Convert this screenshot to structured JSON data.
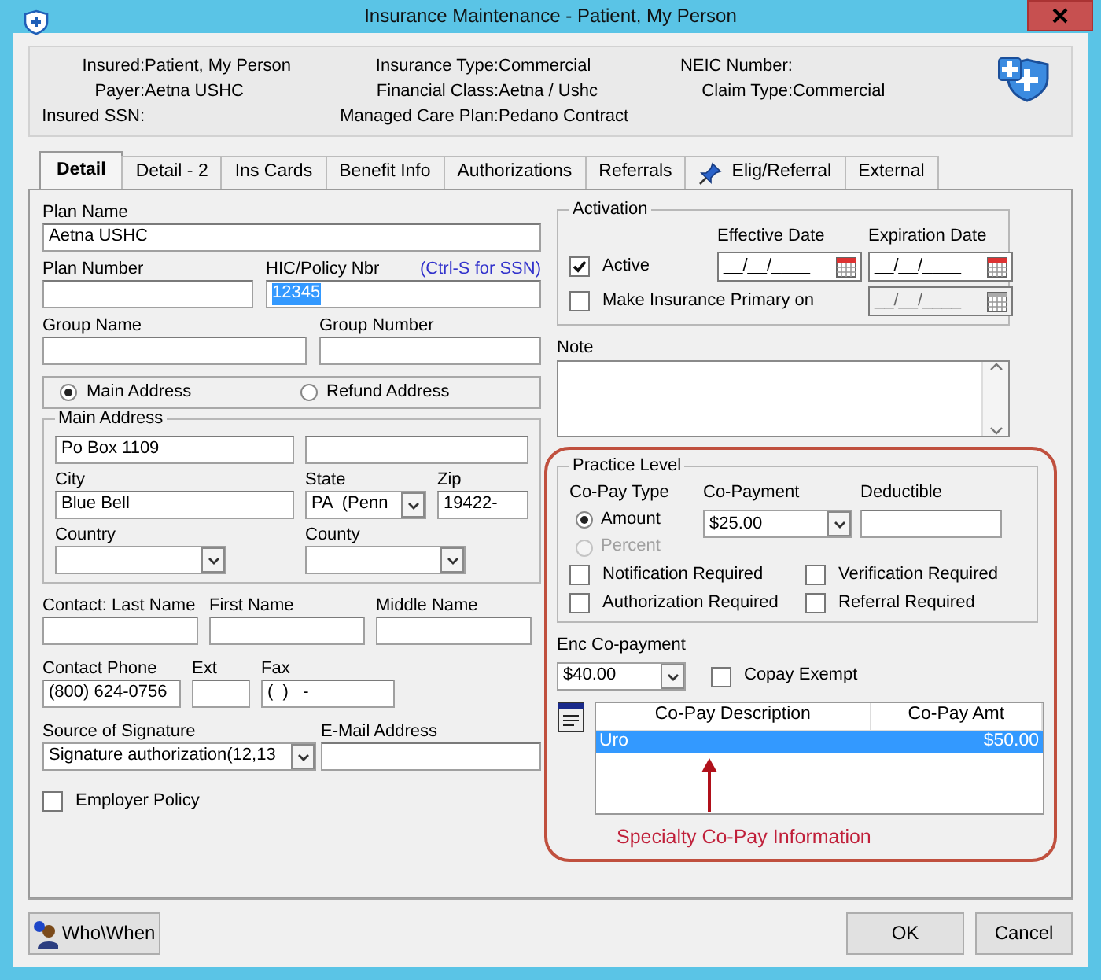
{
  "window": {
    "title": "Insurance Maintenance - Patient, My Person"
  },
  "header": {
    "columns": [
      {
        "fields": [
          {
            "label": "Insured:",
            "value": "Patient, My Person"
          },
          {
            "label": "Payer:",
            "value": "Aetna USHC"
          },
          {
            "label": "Insured SSN:"
          }
        ]
      },
      {
        "fields": [
          {
            "label": "Insurance Type:",
            "value": "Commercial"
          },
          {
            "label": "Financial Class:",
            "value": "Aetna / Ushc"
          },
          {
            "label": "Managed Care Plan:",
            "value": "Pedano Contract"
          }
        ]
      },
      {
        "fields": [
          {
            "label": "NEIC Number:"
          },
          {
            "label": "Claim Type:",
            "value": "Commercial"
          }
        ]
      }
    ]
  },
  "tabs": [
    {
      "label": "Detail",
      "selected": true,
      "pinned": false
    },
    {
      "label": "Detail - 2",
      "selected": false,
      "pinned": false
    },
    {
      "label": "Ins Cards",
      "selected": false,
      "pinned": false
    },
    {
      "label": "Benefit Info",
      "selected": false,
      "pinned": false
    },
    {
      "label": "Authorizations",
      "selected": false,
      "pinned": false
    },
    {
      "label": "Referrals",
      "selected": false,
      "pinned": false
    },
    {
      "label": "Elig/Referral",
      "selected": false,
      "pinned": true
    },
    {
      "label": "External",
      "selected": false,
      "pinned": false
    }
  ],
  "left": {
    "plan_name": {
      "label": "Plan Name",
      "value": "Aetna USHC"
    },
    "plan_number": {
      "label": "Plan Number"
    },
    "policy_number": {
      "label": "HIC/Policy Nbr",
      "hint": "(Ctrl-S for SSN)",
      "value": "12345",
      "highlighted": true
    },
    "group_name": {
      "label": "Group Name"
    },
    "group_number": {
      "label": "Group Number"
    },
    "address_options": [
      {
        "label": "Main Address",
        "selected": true
      },
      {
        "label": "Refund Address",
        "selected": false
      }
    ],
    "main_address": {
      "title": "Main Address",
      "line_1": "Po Box 1109",
      "city": {
        "label": "City",
        "value": "Blue Bell"
      },
      "state": {
        "label": "State",
        "value": "PA  (Penn"
      },
      "zip": {
        "label": "Zip",
        "value": "19422-"
      },
      "country": {
        "label": "Country"
      },
      "county": {
        "label": "County"
      }
    },
    "contact_names": [
      {
        "label": "Contact: Last Name"
      },
      {
        "label": "First Name"
      },
      {
        "label": "Middle Name"
      }
    ],
    "contact_phone": {
      "label": "Contact Phone",
      "value": "(800) 624-0756"
    },
    "ext": {
      "label": "Ext"
    },
    "fax": {
      "label": "Fax",
      "value": "(  )   -"
    },
    "source_of_signature": {
      "label": "Source of Signature",
      "value": "Signature authorization(12,13"
    },
    "email": {
      "label": "E-Mail Address"
    },
    "employer_policy": {
      "label": "Employer Policy",
      "checked": false
    }
  },
  "right": {
    "activation": {
      "title": "Activation",
      "effective_label": "Effective Date",
      "expiration_label": "Expiration Date",
      "active": {
        "label": "Active",
        "checked": true
      },
      "effective_date": "__/__/____",
      "expiration_date": "__/__/____",
      "primary": {
        "label": "Make Insurance Primary on",
        "checked": false
      },
      "primary_date": {
        "value": "__/__/____",
        "disabled": true
      }
    },
    "note": {
      "label": "Note"
    },
    "practice_level": {
      "title": "Practice Level",
      "copay_type_label": "Co-Pay Type",
      "copay_types": [
        {
          "label": "Amount",
          "selected": true,
          "disabled": false
        },
        {
          "label": "Percent",
          "selected": false,
          "disabled": true
        }
      ],
      "copayment": {
        "label": "Co-Payment",
        "value": "$25.00"
      },
      "deductible": {
        "label": "Deductible"
      },
      "flags": [
        {
          "label": "Notification Required",
          "checked": false
        },
        {
          "label": "Verification Required",
          "checked": false
        },
        {
          "label": "Authorization Required",
          "checked": false
        },
        {
          "label": "Referral Required",
          "checked": false
        }
      ]
    },
    "enc_copayment": {
      "label": "Enc Co-payment",
      "value": "$40.00"
    },
    "copay_exempt": {
      "label": "Copay Exempt",
      "checked": false
    },
    "copay_table": {
      "columns": [
        "Co-Pay Description",
        "Co-Pay Amt"
      ],
      "rows": [
        {
          "cells": [
            "Uro",
            "$50.00"
          ],
          "selected": true
        }
      ]
    },
    "annotation": {
      "text": "Specialty Co-Pay Information"
    }
  },
  "buttons": [
    {
      "label": "Who\\When",
      "kind": "info"
    },
    {
      "label": "OK",
      "kind": "plain"
    },
    {
      "label": "Cancel",
      "kind": "plain"
    }
  ]
}
